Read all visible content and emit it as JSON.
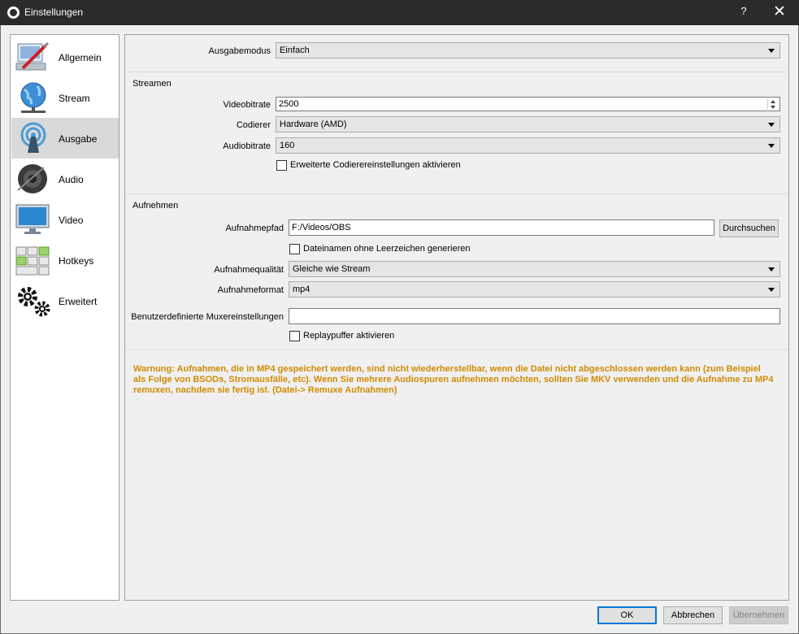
{
  "window": {
    "title": "Einstellungen",
    "help": "?",
    "close": "✕"
  },
  "sidebar": {
    "items": [
      {
        "label": "Allgemein",
        "icon": "general-settings-icon"
      },
      {
        "label": "Stream",
        "icon": "globe-network-icon"
      },
      {
        "label": "Ausgabe",
        "icon": "broadcast-antenna-icon",
        "selected": true
      },
      {
        "label": "Audio",
        "icon": "speaker-icon"
      },
      {
        "label": "Video",
        "icon": "monitor-icon"
      },
      {
        "label": "Hotkeys",
        "icon": "keyboard-icon"
      },
      {
        "label": "Erweitert",
        "icon": "gears-icon"
      }
    ]
  },
  "output_mode": {
    "label": "Ausgabemodus",
    "value": "Einfach"
  },
  "streaming": {
    "title": "Streamen",
    "video_bitrate": {
      "label": "Videobitrate",
      "value": "2500"
    },
    "encoder": {
      "label": "Codierer",
      "value": "Hardware (AMD)"
    },
    "audio_bitrate": {
      "label": "Audiobitrate",
      "value": "160"
    },
    "advanced_encoder": {
      "label": "Erweiterte Codierereinstellungen aktivieren",
      "checked": false
    }
  },
  "recording": {
    "title": "Aufnehmen",
    "path": {
      "label": "Aufnahmepfad",
      "value": "F:/Videos/OBS",
      "browse": "Durchsuchen"
    },
    "no_spaces": {
      "label": "Dateinamen ohne Leerzeichen generieren",
      "checked": false
    },
    "quality": {
      "label": "Aufnahmequalität",
      "value": "Gleiche wie Stream"
    },
    "format": {
      "label": "Aufnahmeformat",
      "value": "mp4"
    },
    "muxer": {
      "label": "Benutzerdefinierte Muxereinstellungen",
      "value": ""
    },
    "replay_buffer": {
      "label": "Replaypuffer aktivieren",
      "checked": false
    }
  },
  "warning": "Warnung: Aufnahmen, die in MP4 gespeichert werden, sind nicht wiederherstellbar, wenn die Datei nicht abgeschlossen werden kann (zum Beispiel als Folge von BSODs, Stromausfälle, etc). Wenn Sie mehrere Audiospuren aufnehmen möchten, sollten Sie MKV verwenden und die Aufnahme zu MP4 remuxen, nachdem sie fertig ist. (Datei-> Remuxe Aufnahmen)",
  "buttons": {
    "ok": "OK",
    "cancel": "Abbrechen",
    "apply": "Übernehmen"
  },
  "colors": {
    "warning": "#d08b00",
    "selected_bg": "#d9d9d9",
    "titlebar": "#2b2b2b"
  }
}
